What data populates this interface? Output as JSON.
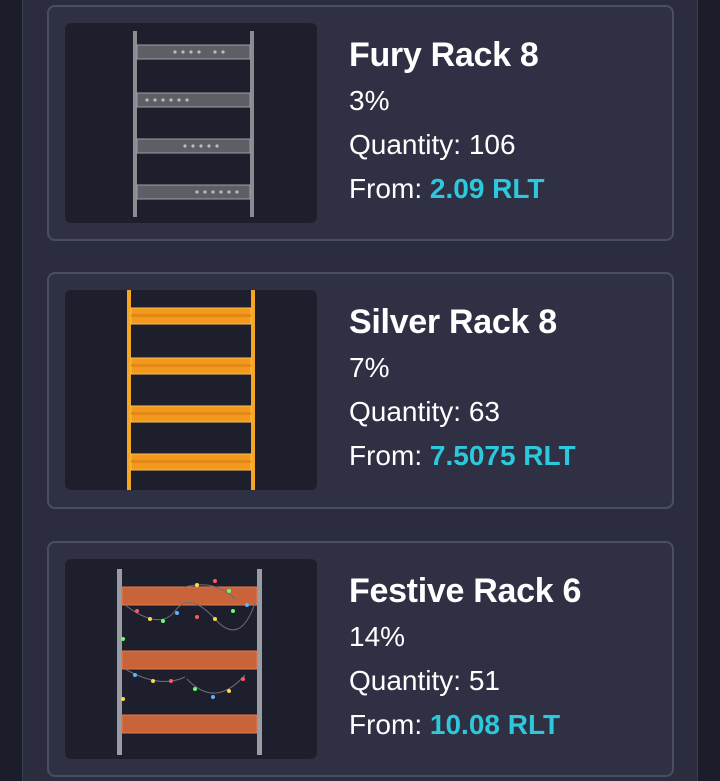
{
  "items": [
    {
      "name": "Fury Rack 8",
      "percent": "3%",
      "quantity_label": "Quantity: 106",
      "from_label": "From:",
      "price": "2.09 RLT",
      "image": "fury-rack-image"
    },
    {
      "name": "Silver Rack 8",
      "percent": "7%",
      "quantity_label": "Quantity: 63",
      "from_label": "From:",
      "price": "7.5075 RLT",
      "image": "silver-rack-image"
    },
    {
      "name": "Festive Rack 6",
      "percent": "14%",
      "quantity_label": "Quantity: 51",
      "from_label": "From:",
      "price": "10.08 RLT",
      "image": "festive-rack-image"
    }
  ],
  "colors": {
    "background": "#1c1d2b",
    "panel": "#2b2c3e",
    "card": "#2f3044",
    "card_border": "#4b4d63",
    "price": "#2ec8dc"
  }
}
